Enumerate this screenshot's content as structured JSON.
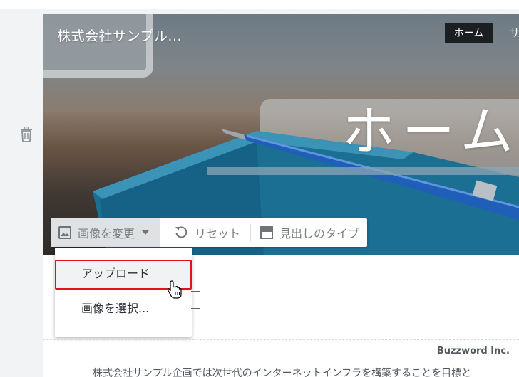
{
  "site": {
    "title": "株式会社サンプル..."
  },
  "nav": {
    "home": "ホーム",
    "next": "サ"
  },
  "hero": {
    "title": "ホーム"
  },
  "toolbar": {
    "change_image": "画像を変更",
    "reset": "リセット",
    "heading_type": "見出しのタイプ"
  },
  "dropdown": {
    "upload": "アップロード",
    "select_image": "画像を選択..."
  },
  "footer": {
    "company": "Buzzword Inc.",
    "body": "株式会社サンプル企画では次世代のインターネットインフラを構築することを目標と"
  },
  "colors": {
    "highlight": "#e2121b",
    "nav_active_bg": "#1b1f22"
  },
  "icons": [
    "trash-icon",
    "image-icon",
    "chevron-down-icon",
    "reset-icon",
    "heading-type-icon",
    "hand-pointer-icon"
  ]
}
